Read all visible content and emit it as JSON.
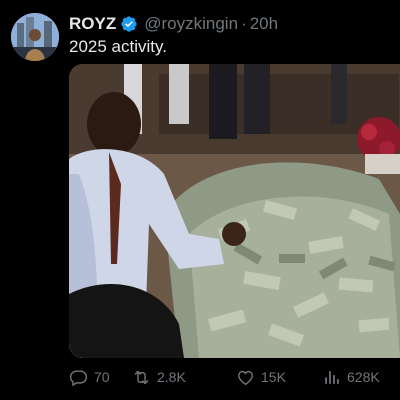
{
  "post": {
    "author_name": "ROYZ",
    "handle": "@royzkingin",
    "separator": "·",
    "time": "20h",
    "text": "2025 activity.",
    "media_alt": "man kneeling beside large pile of banknotes"
  },
  "actions": {
    "replies": "70",
    "reposts": "2.8K",
    "likes": "15K",
    "views": "628K"
  },
  "icons": {
    "verified": "verified-badge-icon",
    "reply": "reply-icon",
    "repost": "repost-icon",
    "like": "heart-icon",
    "views": "views-chart-icon"
  },
  "colors": {
    "background": "#000000",
    "text": "#e7e9ea",
    "muted": "#71767b",
    "verified": "#1d9bf0"
  }
}
